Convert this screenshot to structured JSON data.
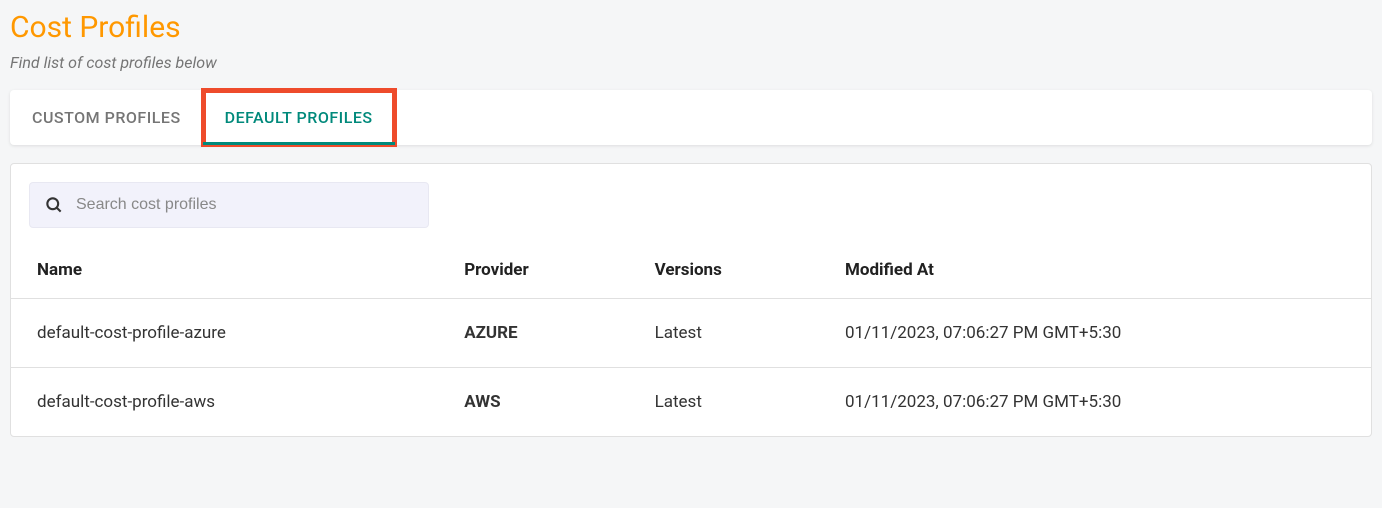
{
  "header": {
    "title": "Cost Profiles",
    "subtitle": "Find list of cost profiles below"
  },
  "tabs": [
    {
      "label": "CUSTOM PROFILES",
      "active": false
    },
    {
      "label": "DEFAULT PROFILES",
      "active": true
    }
  ],
  "search": {
    "placeholder": "Search cost profiles",
    "value": ""
  },
  "table": {
    "columns": {
      "name": "Name",
      "provider": "Provider",
      "versions": "Versions",
      "modified": "Modified At"
    },
    "rows": [
      {
        "name": "default-cost-profile-azure",
        "provider": "AZURE",
        "versions": "Latest",
        "modified": "01/11/2023, 07:06:27 PM GMT+5:30"
      },
      {
        "name": "default-cost-profile-aws",
        "provider": "AWS",
        "versions": "Latest",
        "modified": "01/11/2023, 07:06:27 PM GMT+5:30"
      }
    ]
  }
}
